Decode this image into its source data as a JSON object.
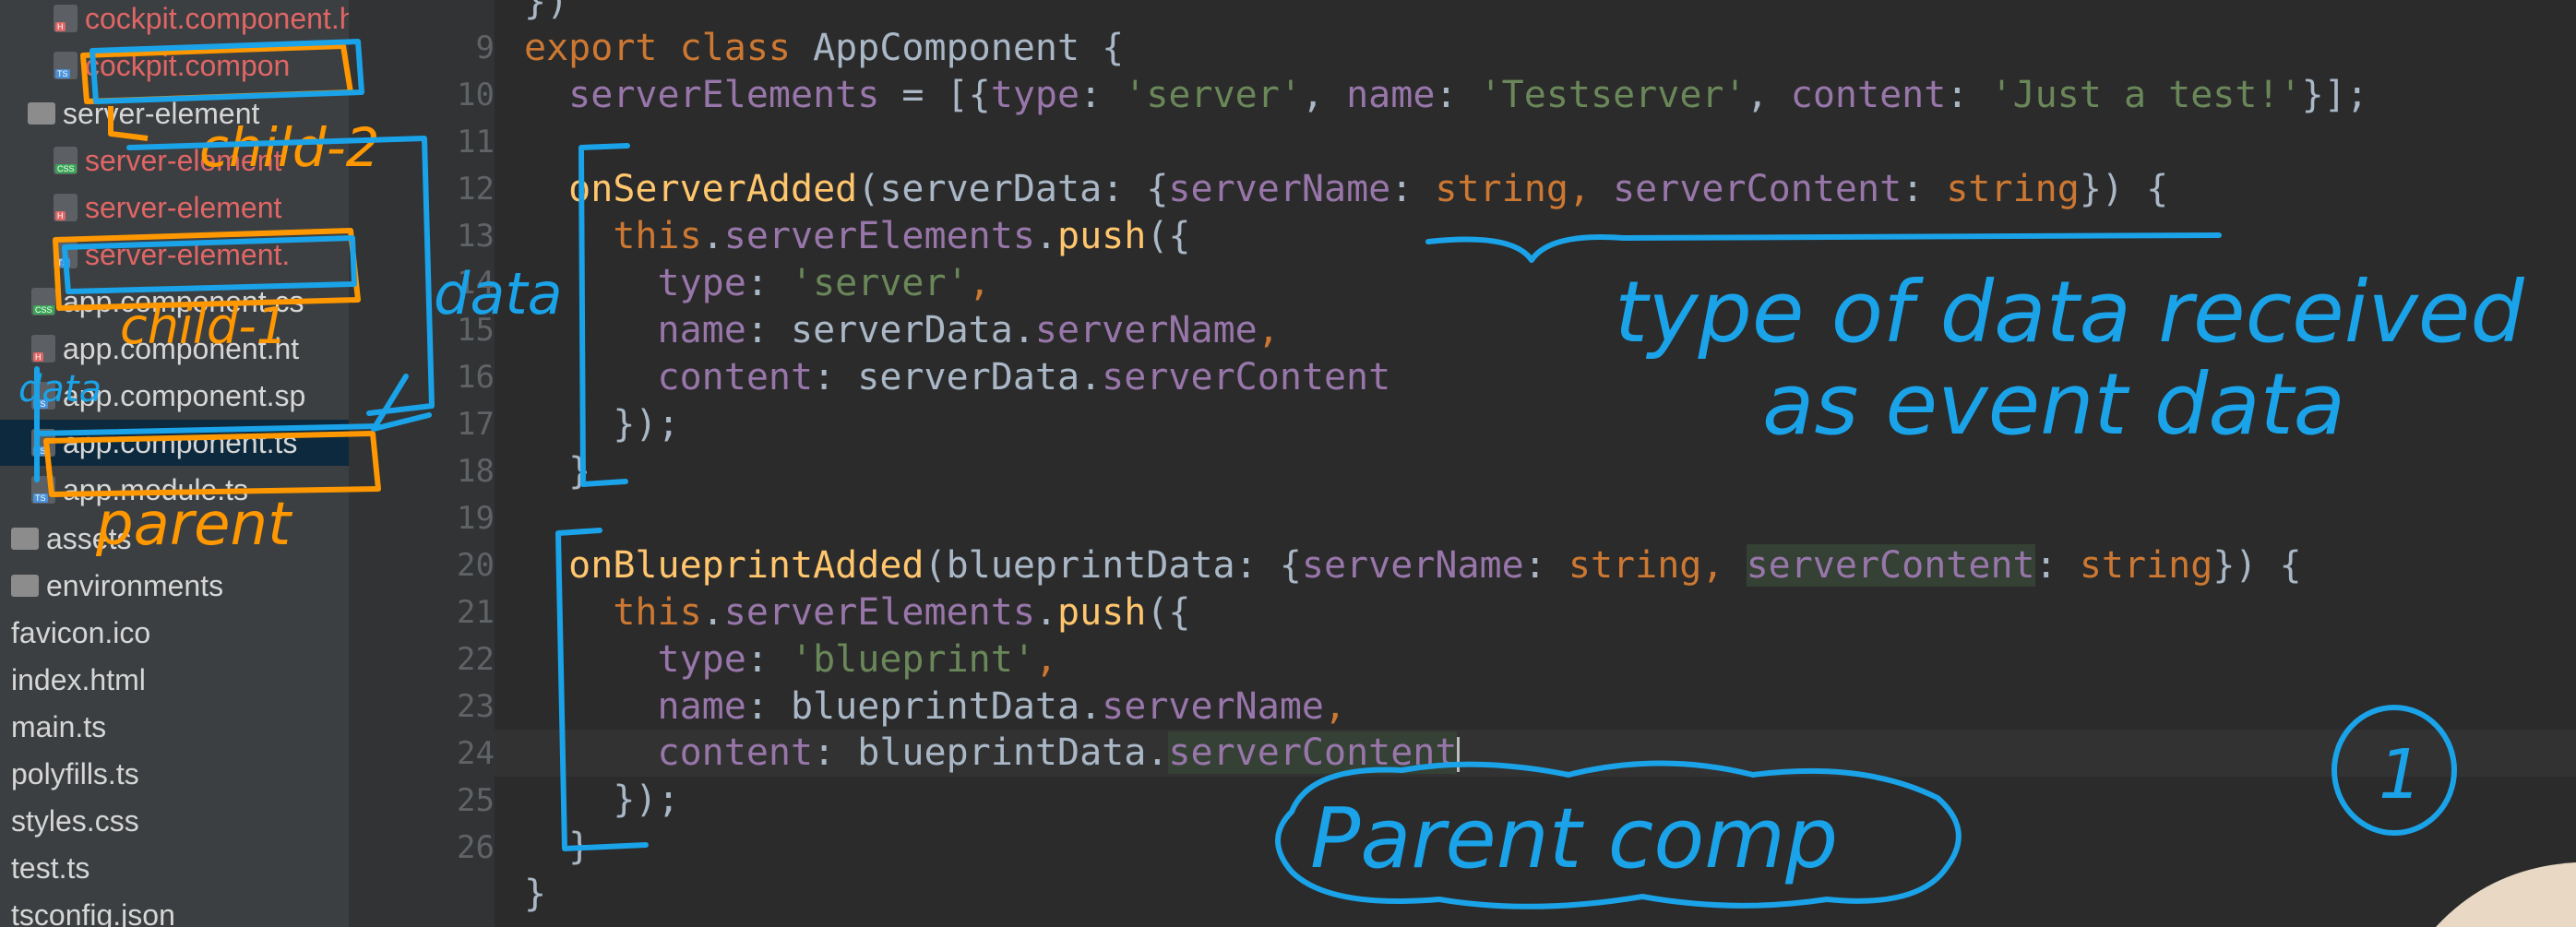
{
  "sidebar": {
    "items": [
      {
        "label": "cockpit.component.html",
        "tag": "H",
        "tag_color": "#e06666",
        "red": true
      },
      {
        "label": "cockpit.compon",
        "tag": "TS",
        "tag_color": "#4a90d9",
        "red": true
      },
      {
        "label": "server-element",
        "folder": true
      },
      {
        "label": "server-element",
        "tag": "CSS",
        "tag_color": "#3aa655",
        "red": true
      },
      {
        "label": "server-element",
        "tag": "H",
        "tag_color": "#e06666",
        "red": true
      },
      {
        "label": "server-element.",
        "tag": "TS",
        "tag_color": "#4a90d9",
        "red": true
      },
      {
        "label": "app.component.cs",
        "tag": "CSS",
        "tag_color": "#3aa655"
      },
      {
        "label": "app.component.ht",
        "tag": "H",
        "tag_color": "#e06666"
      },
      {
        "label": "app.component.sp",
        "tag": "TS",
        "tag_color": "#4a90d9"
      },
      {
        "label": "app.component.ts",
        "tag": "TS",
        "tag_color": "#4a90d9",
        "selected": true
      },
      {
        "label": "app.module.ts",
        "tag": "TS",
        "tag_color": "#4a90d9"
      },
      {
        "label": "assets",
        "folder": true
      },
      {
        "label": "environments",
        "folder": true
      },
      {
        "label": "favicon.ico"
      },
      {
        "label": "index.html"
      },
      {
        "label": "main.ts"
      },
      {
        "label": "polyfills.ts"
      },
      {
        "label": "styles.css"
      },
      {
        "label": "test.ts"
      },
      {
        "label": "tsconfig.json"
      }
    ]
  },
  "editor": {
    "line_numbers": [
      "9",
      "10",
      "11",
      "12",
      "13",
      "14",
      "15",
      "16",
      "17",
      "18",
      "19",
      "20",
      "21",
      "22",
      "23",
      "24",
      "25",
      "26"
    ],
    "code": {
      "l8": "})",
      "l9_kw": "export class ",
      "l9_name": "AppComponent {",
      "l10_prop": "serverElements",
      "l10_a": " = [{",
      "l10_k1": "type",
      "l10_s1": "'server'",
      "l10_k2": "name",
      "l10_s2": "'Testserver'",
      "l10_k3": "content",
      "l10_s3": "'Just a test!'",
      "l10_end": "}];",
      "l12_fn": "onServerAdded",
      "l12_a": "(serverData: {",
      "l12_p1": "serverName",
      "l12_t1": "string",
      "l12_p2": "serverContent",
      "l12_t2": "string",
      "l12_end": "}) {",
      "l13_this": "this",
      "l13_prop": "serverElements",
      "l13_fn": "push",
      "l13_end": "({",
      "l14_k": "type",
      "l14_s": "'server'",
      "l15_k": "name",
      "l15_v": "serverData.",
      "l15_p": "serverName",
      "l16_k": "content",
      "l16_v": "serverData.",
      "l16_p": "serverContent",
      "l17": "});",
      "l18": "}",
      "l20_fn": "onBlueprintAdded",
      "l20_a": "(blueprintData: {",
      "l20_p1": "serverName",
      "l20_t1": "string",
      "l20_p2": "serverContent",
      "l20_t2": "string",
      "l20_end": "}) {",
      "l21_this": "this",
      "l21_prop": "serverElements",
      "l21_fn": "push",
      "l21_end": "({",
      "l22_k": "type",
      "l22_s": "'blueprint'",
      "l23_k": "name",
      "l23_v": "blueprintData.",
      "l23_p": "serverName",
      "l24_k": "content",
      "l24_v": "blueprintData.",
      "l24_p": "serverContent",
      "l25": "});",
      "l26": "}",
      "l27": "}"
    }
  },
  "annotations": {
    "child2": "child-2",
    "child1": "child-1",
    "data_left": "data",
    "data_small": "data",
    "parent": "parent",
    "type_line1": "type of data received",
    "type_line2": "as event data",
    "parent_comp": "Parent comp",
    "circle_num": "1"
  },
  "colors": {
    "annotation_blue": "#1aa3e8",
    "annotation_orange": "#ff9800"
  }
}
